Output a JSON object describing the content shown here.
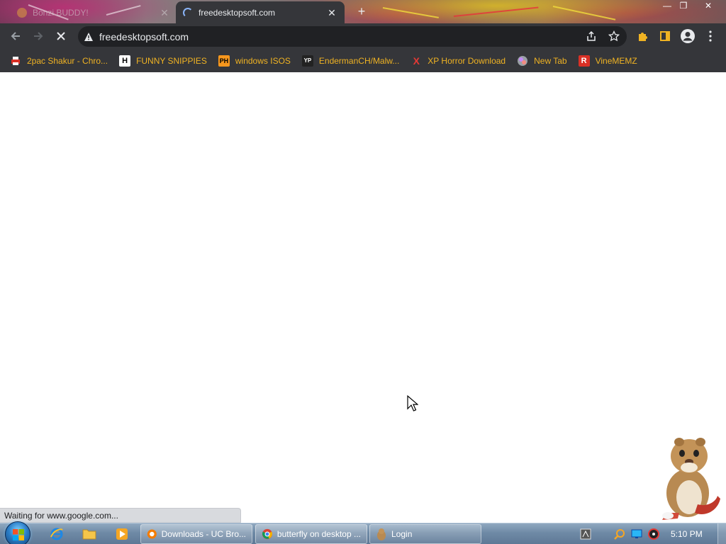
{
  "browser": {
    "tabs": [
      {
        "title": "Bonzi BUDDY!"
      },
      {
        "title": "freedesktopsoft.com"
      }
    ],
    "address": "freedesktopsoft.com",
    "bookmarks": [
      {
        "label": "2pac Shakur - Chro...",
        "icon": "printer-icon"
      },
      {
        "label": "FUNNY SNIPPIES",
        "icon": "h-logo-icon",
        "glyph": "H"
      },
      {
        "label": "windows ISOS",
        "icon": "ph-logo-icon",
        "glyph": "PH"
      },
      {
        "label": "EndermanCH/Malw...",
        "icon": "yp-logo-icon",
        "glyph": "YP"
      },
      {
        "label": "XP Horror Download",
        "icon": "x-logo-icon",
        "glyph": "X"
      },
      {
        "label": "New Tab",
        "icon": "globe-icon"
      },
      {
        "label": "VineMEMZ",
        "icon": "r-logo-icon",
        "glyph": "R"
      }
    ],
    "status_text": "Waiting for www.google.com...",
    "colors": {
      "tab_active": "#35363a",
      "toolbar": "#35363a",
      "bookmark_text": "#f0b323",
      "spinner": "#8ab4f8"
    }
  },
  "taskbar": {
    "tasks": [
      {
        "label": "Downloads - UC Bro..."
      },
      {
        "label": "butterfly on desktop ..."
      },
      {
        "label": "Login"
      }
    ],
    "clock": "5:10 PM"
  }
}
